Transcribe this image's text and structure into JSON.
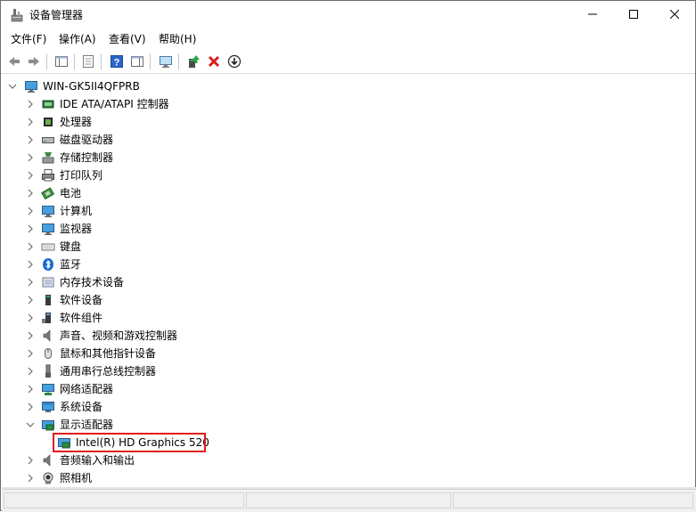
{
  "window": {
    "title": "设备管理器",
    "icon": "device-manager-icon",
    "controls": {
      "minimize": "—",
      "maximize": "☐",
      "close": "✕"
    }
  },
  "menu": [
    {
      "id": "file",
      "label": "文件(F)"
    },
    {
      "id": "action",
      "label": "操作(A)"
    },
    {
      "id": "view",
      "label": "查看(V)"
    },
    {
      "id": "help",
      "label": "帮助(H)"
    }
  ],
  "toolbar": [
    {
      "id": "back",
      "icon": "back-arrow-icon"
    },
    {
      "id": "forward",
      "icon": "forward-arrow-icon"
    },
    {
      "id": "show-hide-console-tree",
      "icon": "console-tree-icon"
    },
    {
      "id": "properties",
      "icon": "properties-icon"
    },
    {
      "id": "help",
      "icon": "help-icon"
    },
    {
      "id": "show-action-pane",
      "icon": "action-pane-icon"
    },
    {
      "id": "scan-hardware",
      "icon": "scan-hardware-icon"
    },
    {
      "id": "update-driver",
      "icon": "update-driver-icon"
    },
    {
      "id": "uninstall-device",
      "icon": "uninstall-icon"
    },
    {
      "id": "download",
      "icon": "download-icon"
    }
  ],
  "tree": {
    "root": {
      "label": "WIN-GK5II4QFPRB",
      "icon": "computer-icon",
      "expanded": true
    },
    "items": [
      {
        "label": "IDE ATA/ATAPI 控制器",
        "icon": "ide-controller-icon"
      },
      {
        "label": "处理器",
        "icon": "processor-icon"
      },
      {
        "label": "磁盘驱动器",
        "icon": "disk-drive-icon"
      },
      {
        "label": "存储控制器",
        "icon": "storage-controller-icon"
      },
      {
        "label": "打印队列",
        "icon": "printer-icon"
      },
      {
        "label": "电池",
        "icon": "battery-icon"
      },
      {
        "label": "计算机",
        "icon": "monitor-icon"
      },
      {
        "label": "监视器",
        "icon": "monitor-icon"
      },
      {
        "label": "键盘",
        "icon": "keyboard-icon"
      },
      {
        "label": "蓝牙",
        "icon": "bluetooth-icon"
      },
      {
        "label": "内存技术设备",
        "icon": "memory-device-icon"
      },
      {
        "label": "软件设备",
        "icon": "software-device-icon"
      },
      {
        "label": "软件组件",
        "icon": "software-component-icon"
      },
      {
        "label": "声音、视频和游戏控制器",
        "icon": "speaker-icon"
      },
      {
        "label": "鼠标和其他指针设备",
        "icon": "mouse-icon"
      },
      {
        "label": "通用串行总线控制器",
        "icon": "usb-icon"
      },
      {
        "label": "网络适配器",
        "icon": "network-adapter-icon"
      },
      {
        "label": "系统设备",
        "icon": "system-device-icon"
      },
      {
        "label": "显示适配器",
        "icon": "display-adapter-icon",
        "expanded": true
      },
      {
        "label": "Intel(R) HD Graphics 520",
        "icon": "display-adapter-icon",
        "child": true,
        "highlighted": true
      },
      {
        "label": "音频输入和输出",
        "icon": "speaker-icon"
      },
      {
        "label": "照相机",
        "icon": "camera-icon"
      }
    ]
  },
  "colors": {
    "highlight_border": "#e01a1a",
    "expander": "#6d6d6d",
    "delete_red": "#d42020"
  }
}
